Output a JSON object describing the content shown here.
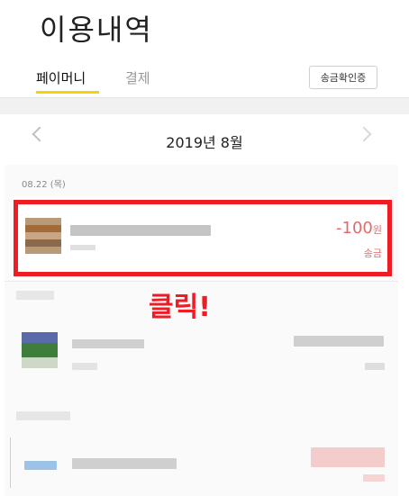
{
  "header": {
    "title": "이용내역"
  },
  "tabs": [
    {
      "label": "페이머니",
      "active": true
    },
    {
      "label": "결제",
      "active": false
    }
  ],
  "actions": {
    "certificate_label": "송금확인증"
  },
  "month_nav": {
    "label": "2019년 8월",
    "prev_icon": "chevron-left-icon",
    "next_icon": "chevron-right-icon"
  },
  "list": {
    "date_header": "08.22 (목)",
    "items": [
      {
        "amount": "-100",
        "unit": "원",
        "type": "송금"
      }
    ]
  },
  "overlay": {
    "annotation": "클릭!"
  },
  "colors": {
    "accent": "#f7d400",
    "highlight": "#ee1c25",
    "amount": "#e56a6a"
  }
}
